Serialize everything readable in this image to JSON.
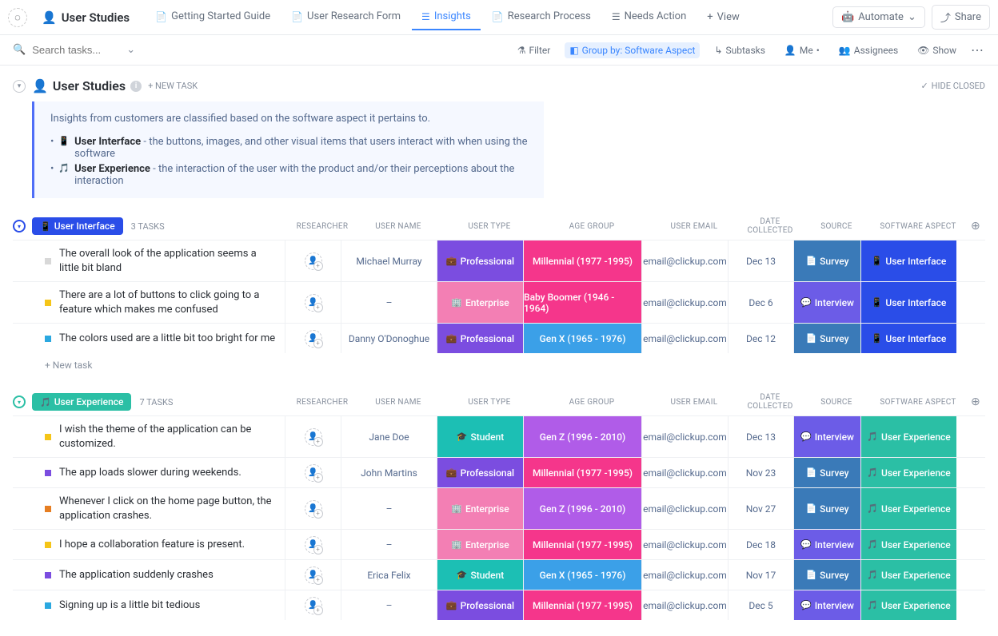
{
  "header": {
    "workspace_title": "User Studies",
    "tabs": [
      {
        "label": "Getting Started Guide"
      },
      {
        "label": "User Research Form"
      },
      {
        "label": "Insights"
      },
      {
        "label": "Research Process"
      },
      {
        "label": "Needs Action"
      }
    ],
    "add_view": "View",
    "automate": "Automate",
    "share": "Share"
  },
  "filter": {
    "search_placeholder": "Search tasks...",
    "filter": "Filter",
    "group_by": "Group by: Software Aspect",
    "subtasks": "Subtasks",
    "me": "Me",
    "assignees": "Assignees",
    "show": "Show"
  },
  "page": {
    "title": "User Studies",
    "new_task": "+ NEW TASK",
    "hide_closed": "HIDE CLOSED"
  },
  "description": {
    "intro": "Insights from customers are classified based on the software aspect it pertains to.",
    "ui_label": "User Interface",
    "ui_text": " - the buttons, images, and other visual items that users interact with when using the software",
    "ux_label": "User Experience",
    "ux_text": " - the interaction of the user with the product and/or their perceptions about the interaction"
  },
  "columns": {
    "researcher": "RESEARCHER",
    "username": "USER NAME",
    "usertype": "USER TYPE",
    "agegroup": "AGE GROUP",
    "email": "USER EMAIL",
    "date": "DATE COLLECTED",
    "source": "SOURCE",
    "aspect": "SOFTWARE ASPECT"
  },
  "groups": [
    {
      "name": "User Interface",
      "color": "#2a4de8",
      "emoji": "📱",
      "count": "3 TASKS",
      "rows": [
        {
          "status": "#d8d8d8",
          "title": "The overall look of the application seems a little bit bland",
          "username": "Michael Murray",
          "usertype": "Professional",
          "ut_class": "professional",
          "ut_emoji": "💼",
          "agegroup": "Millennial (1977 -1995)",
          "ag_class": "millennial",
          "email": "email@clickup.com",
          "date": "Dec 13",
          "source": "Survey",
          "src_class": "survey",
          "src_emoji": "📄",
          "aspect": "User Interface",
          "aspect_class": "ui",
          "aspect_emoji": "📱"
        },
        {
          "status": "#f5c518",
          "title": "There are a lot of buttons to click going to a feature which makes me confused",
          "username": "–",
          "usertype": "Enterprise",
          "ut_class": "enterprise",
          "ut_emoji": "🏢",
          "agegroup": "Baby Boomer (1946 - 1964)",
          "ag_class": "babyboomer",
          "email": "email@clickup.com",
          "date": "Dec 6",
          "source": "Interview",
          "src_class": "interview",
          "src_emoji": "💬",
          "aspect": "User Interface",
          "aspect_class": "ui",
          "aspect_emoji": "📱"
        },
        {
          "status": "#2ba8e0",
          "title": "The colors used are a little bit too bright for me",
          "username": "Danny O'Donoghue",
          "usertype": "Professional",
          "ut_class": "professional",
          "ut_emoji": "💼",
          "agegroup": "Gen X (1965 - 1976)",
          "ag_class": "genx",
          "email": "email@clickup.com",
          "date": "Dec 12",
          "source": "Survey",
          "src_class": "survey",
          "src_emoji": "📄",
          "aspect": "User Interface",
          "aspect_class": "ui",
          "aspect_emoji": "📱"
        }
      ],
      "new_task": "+ New task"
    },
    {
      "name": "User Experience",
      "color": "#2bbfa5",
      "emoji": "🎵",
      "count": "7 TASKS",
      "rows": [
        {
          "status": "#f5c518",
          "title": "I wish the theme of the application can be customized.",
          "username": "Jane Doe",
          "usertype": "Student",
          "ut_class": "student",
          "ut_emoji": "🎓",
          "agegroup": "Gen Z (1996 - 2010)",
          "ag_class": "genz",
          "email": "email@clickup.com",
          "date": "Dec 13",
          "source": "Interview",
          "src_class": "interview",
          "src_emoji": "💬",
          "aspect": "User Experience",
          "aspect_class": "ux",
          "aspect_emoji": "🎵"
        },
        {
          "status": "#7b4de0",
          "title": "The app loads slower during weekends.",
          "username": "John Martins",
          "usertype": "Professional",
          "ut_class": "professional",
          "ut_emoji": "💼",
          "agegroup": "Millennial (1977 -1995)",
          "ag_class": "millennial",
          "email": "email@clickup.com",
          "date": "Nov 23",
          "source": "Survey",
          "src_class": "survey",
          "src_emoji": "📄",
          "aspect": "User Experience",
          "aspect_class": "ux",
          "aspect_emoji": "🎵"
        },
        {
          "status": "#e67e22",
          "title": "Whenever I click on the home page button, the application crashes.",
          "username": "–",
          "usertype": "Enterprise",
          "ut_class": "enterprise",
          "ut_emoji": "🏢",
          "agegroup": "Gen Z (1996 - 2010)",
          "ag_class": "genz",
          "email": "email@clickup.com",
          "date": "Nov 27",
          "source": "Survey",
          "src_class": "survey",
          "src_emoji": "📄",
          "aspect": "User Experience",
          "aspect_class": "ux",
          "aspect_emoji": "🎵"
        },
        {
          "status": "#f5c518",
          "title": "I hope a collaboration feature is present.",
          "username": "–",
          "usertype": "Enterprise",
          "ut_class": "enterprise",
          "ut_emoji": "🏢",
          "agegroup": "Millennial (1977 -1995)",
          "ag_class": "millennial",
          "email": "email@clickup.com",
          "date": "Dec 18",
          "source": "Interview",
          "src_class": "interview",
          "src_emoji": "💬",
          "aspect": "User Experience",
          "aspect_class": "ux",
          "aspect_emoji": "🎵"
        },
        {
          "status": "#7b4de0",
          "title": "The application suddenly crashes",
          "username": "Erica Felix",
          "usertype": "Student",
          "ut_class": "student",
          "ut_emoji": "🎓",
          "agegroup": "Gen X (1965 - 1976)",
          "ag_class": "genx",
          "email": "email@clickup.com",
          "date": "Nov 17",
          "source": "Survey",
          "src_class": "survey",
          "src_emoji": "📄",
          "aspect": "User Experience",
          "aspect_class": "ux",
          "aspect_emoji": "🎵"
        },
        {
          "status": "#2ba8e0",
          "title": "Signing up is a little bit tedious",
          "username": "–",
          "usertype": "Professional",
          "ut_class": "professional",
          "ut_emoji": "💼",
          "agegroup": "Millennial (1977 -1995)",
          "ag_class": "millennial",
          "email": "email@clickup.com",
          "date": "Dec 5",
          "source": "Interview",
          "src_class": "interview",
          "src_emoji": "💬",
          "aspect": "User Experience",
          "aspect_class": "ux",
          "aspect_emoji": "🎵"
        }
      ]
    }
  ]
}
